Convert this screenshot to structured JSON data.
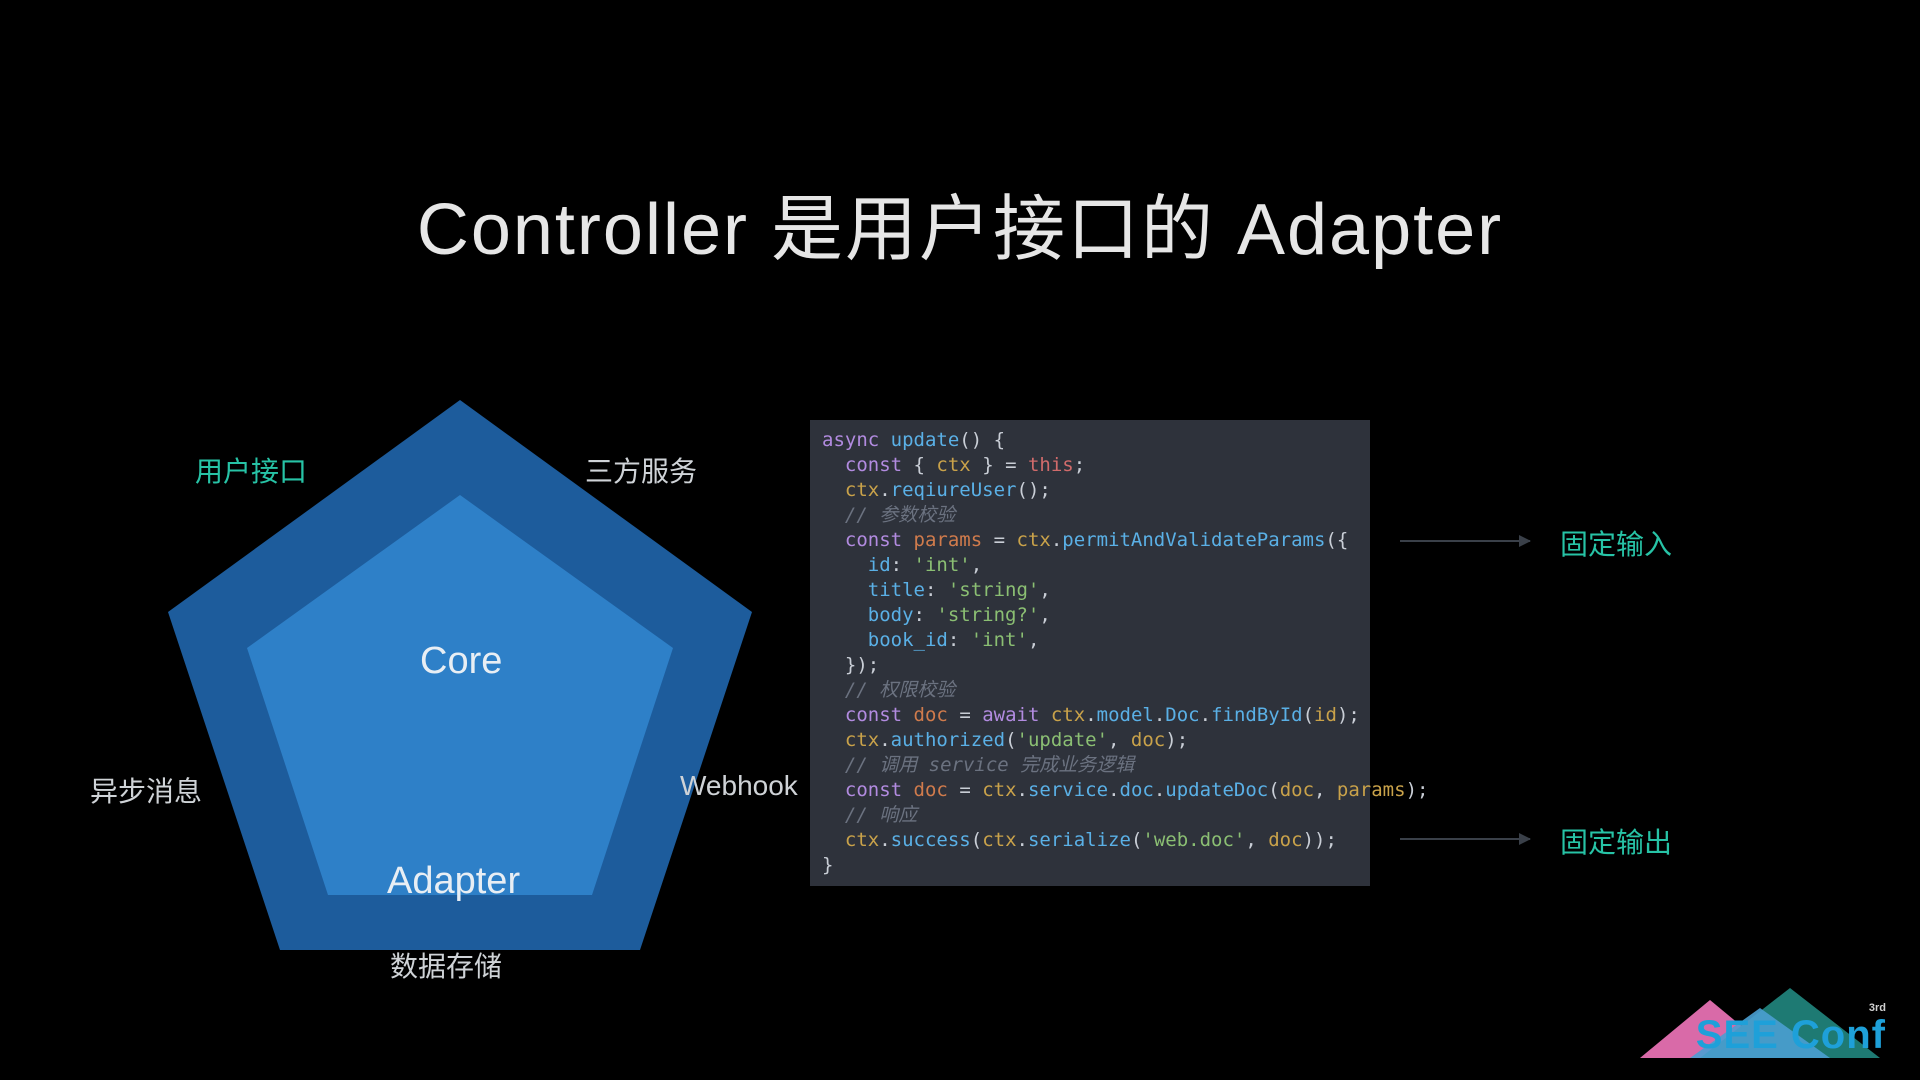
{
  "title": "Controller 是用户接口的 Adapter",
  "pentagon": {
    "core_label": "Core",
    "adapter_label": "Adapter",
    "labels": {
      "top_left": "用户接口",
      "top_right": "三方服务",
      "mid_left": "异步消息",
      "mid_right": "Webhook",
      "bottom": "数据存储"
    }
  },
  "code": {
    "lines": [
      [
        [
          "kw",
          "async"
        ],
        [
          "punc",
          " "
        ],
        [
          "fn",
          "update"
        ],
        [
          "punc",
          "() {"
        ]
      ],
      [
        [
          "punc",
          "  "
        ],
        [
          "kw",
          "const"
        ],
        [
          "punc",
          " { "
        ],
        [
          "id",
          "ctx"
        ],
        [
          "punc",
          " } = "
        ],
        [
          "this",
          "this"
        ],
        [
          "punc",
          ";"
        ]
      ],
      [
        [
          "punc",
          "  "
        ],
        [
          "id",
          "ctx"
        ],
        [
          "punc",
          "."
        ],
        [
          "fn",
          "reqiureUser"
        ],
        [
          "punc",
          "();"
        ]
      ],
      [
        [
          "punc",
          "  "
        ],
        [
          "com",
          "// 参数校验"
        ]
      ],
      [
        [
          "punc",
          "  "
        ],
        [
          "kw",
          "const"
        ],
        [
          "punc",
          " "
        ],
        [
          "param",
          "params"
        ],
        [
          "punc",
          " = "
        ],
        [
          "id",
          "ctx"
        ],
        [
          "punc",
          "."
        ],
        [
          "fn",
          "permitAndValidateParams"
        ],
        [
          "punc",
          "({"
        ]
      ],
      [
        [
          "punc",
          "    "
        ],
        [
          "prop",
          "id"
        ],
        [
          "punc",
          ": "
        ],
        [
          "str",
          "'int'"
        ],
        [
          "punc",
          ","
        ]
      ],
      [
        [
          "punc",
          "    "
        ],
        [
          "prop",
          "title"
        ],
        [
          "punc",
          ": "
        ],
        [
          "str",
          "'string'"
        ],
        [
          "punc",
          ","
        ]
      ],
      [
        [
          "punc",
          "    "
        ],
        [
          "prop",
          "body"
        ],
        [
          "punc",
          ": "
        ],
        [
          "str",
          "'string?'"
        ],
        [
          "punc",
          ","
        ]
      ],
      [
        [
          "punc",
          "    "
        ],
        [
          "prop",
          "book_id"
        ],
        [
          "punc",
          ": "
        ],
        [
          "str",
          "'int'"
        ],
        [
          "punc",
          ","
        ]
      ],
      [
        [
          "punc",
          "  });"
        ]
      ],
      [
        [
          "punc",
          "  "
        ],
        [
          "com",
          "// 权限校验"
        ]
      ],
      [
        [
          "punc",
          "  "
        ],
        [
          "kw",
          "const"
        ],
        [
          "punc",
          " "
        ],
        [
          "param",
          "doc"
        ],
        [
          "punc",
          " = "
        ],
        [
          "kw",
          "await"
        ],
        [
          "punc",
          " "
        ],
        [
          "id",
          "ctx"
        ],
        [
          "punc",
          "."
        ],
        [
          "prop",
          "model"
        ],
        [
          "punc",
          "."
        ],
        [
          "prop",
          "Doc"
        ],
        [
          "punc",
          "."
        ],
        [
          "fn",
          "findById"
        ],
        [
          "punc",
          "("
        ],
        [
          "id",
          "id"
        ],
        [
          "punc",
          ");"
        ]
      ],
      [
        [
          "punc",
          "  "
        ],
        [
          "id",
          "ctx"
        ],
        [
          "punc",
          "."
        ],
        [
          "fn",
          "authorized"
        ],
        [
          "punc",
          "("
        ],
        [
          "str",
          "'update'"
        ],
        [
          "punc",
          ", "
        ],
        [
          "id",
          "doc"
        ],
        [
          "punc",
          ");"
        ]
      ],
      [
        [
          "punc",
          "  "
        ],
        [
          "com",
          "// 调用 service 完成业务逻辑"
        ]
      ],
      [
        [
          "punc",
          "  "
        ],
        [
          "kw",
          "const"
        ],
        [
          "punc",
          " "
        ],
        [
          "param",
          "doc"
        ],
        [
          "punc",
          " = "
        ],
        [
          "id",
          "ctx"
        ],
        [
          "punc",
          "."
        ],
        [
          "prop",
          "service"
        ],
        [
          "punc",
          "."
        ],
        [
          "prop",
          "doc"
        ],
        [
          "punc",
          "."
        ],
        [
          "fn",
          "updateDoc"
        ],
        [
          "punc",
          "("
        ],
        [
          "id",
          "doc"
        ],
        [
          "punc",
          ", "
        ],
        [
          "id",
          "params"
        ],
        [
          "punc",
          ");"
        ]
      ],
      [
        [
          "punc",
          "  "
        ],
        [
          "com",
          "// 响应"
        ]
      ],
      [
        [
          "punc",
          "  "
        ],
        [
          "id",
          "ctx"
        ],
        [
          "punc",
          "."
        ],
        [
          "fn",
          "success"
        ],
        [
          "punc",
          "("
        ],
        [
          "id",
          "ctx"
        ],
        [
          "punc",
          "."
        ],
        [
          "fn",
          "serialize"
        ],
        [
          "punc",
          "("
        ],
        [
          "str",
          "'web.doc'"
        ],
        [
          "punc",
          ", "
        ],
        [
          "id",
          "doc"
        ],
        [
          "punc",
          "));"
        ]
      ],
      [
        [
          "punc",
          "}"
        ]
      ]
    ]
  },
  "annotations": {
    "input": "固定输入",
    "output": "固定输出"
  },
  "brand": {
    "text": "SEE Conf",
    "sup": "3rd"
  }
}
